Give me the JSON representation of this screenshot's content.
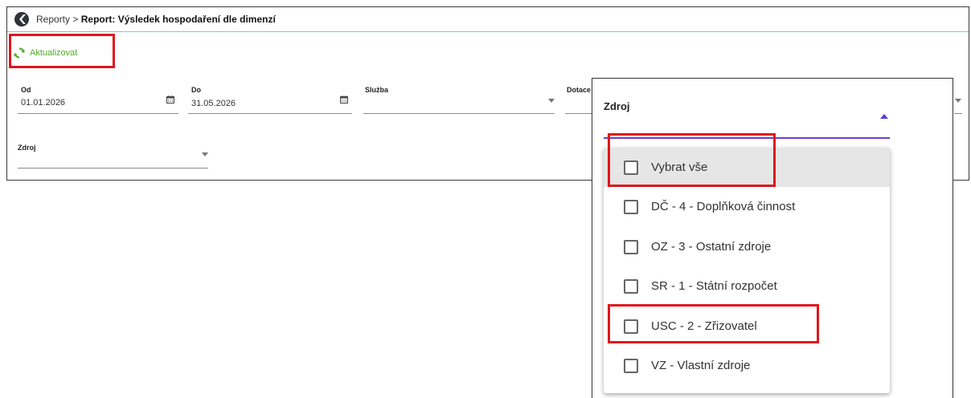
{
  "breadcrumb": {
    "root": "Reporty",
    "separator": ">",
    "title": "Report: Výsledek hospodaření dle dimenzí"
  },
  "toolbar": {
    "refresh_label": "Aktualizovat",
    "refresh_icon": "refresh-icon"
  },
  "filters": {
    "od": {
      "label": "Od",
      "value": "01.01.2026",
      "icon": "calendar-icon"
    },
    "do": {
      "label": "Do",
      "value": "31.05.2026",
      "icon": "calendar-icon"
    },
    "sluzba": {
      "label": "Služba",
      "value": ""
    },
    "dotace": {
      "label": "Dotace",
      "value": ""
    },
    "zdroj": {
      "label": "Zdroj",
      "value": ""
    }
  },
  "dropdown": {
    "label": "Zdroj",
    "options": [
      "Vybrat vše",
      "DČ - 4 - Doplňková činnost",
      "OZ - 3 - Ostatní zdroje",
      "SR - 1 - Státní rozpočet",
      "USC - 2 - Zřizovatel",
      "VZ - Vlastní zdroje"
    ]
  },
  "colors": {
    "accent": "#6a3fd0",
    "refresh": "#4caf1f",
    "highlight": "#e0161b"
  }
}
